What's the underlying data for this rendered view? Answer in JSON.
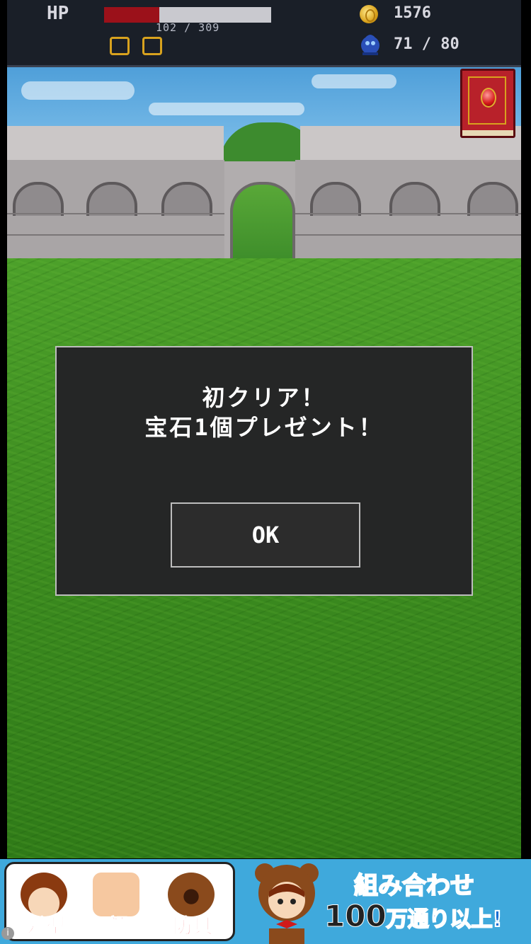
{
  "hud": {
    "hp_label": "HP",
    "hp_text": "102 / 309",
    "hp_fraction": 0.33,
    "coins": "1576",
    "monsters": "71 / 80"
  },
  "dialog": {
    "line1": "初クリア！",
    "line2": "宝石1個プレゼント！",
    "ok_label": "OK"
  },
  "ad": {
    "labels": [
      "髪型",
      "顔",
      "防具"
    ],
    "title": "組み合わせ",
    "sub_big": "100",
    "sub_rest": "万通り以上!",
    "info": "i"
  },
  "colors": {
    "hp_fill": "#9b111a",
    "dialog_bg": "#252626",
    "grass": "#3d8a22"
  }
}
